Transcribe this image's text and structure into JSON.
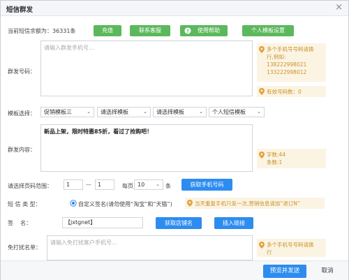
{
  "title": "短信群发",
  "close_glyph": "×",
  "balance": {
    "label": "当前短信余额为：",
    "value": "36331条"
  },
  "toolbar": {
    "recharge": "充值",
    "service": "联系客服",
    "help": "使用帮助",
    "template_settings": "个人模板设置"
  },
  "group_numbers": {
    "label": "群发号码：",
    "placeholder": "请输入群发手机号...",
    "tip_lines": [
      "多个手机号号码请换",
      "行,例如:",
      "138222998021",
      "133222998012"
    ],
    "valid_count": "有效号码数：0"
  },
  "templates": {
    "label": "模板选择：",
    "options": [
      "促销模板三",
      "请选择模板",
      "请选择模板",
      "个人短信模板"
    ]
  },
  "content": {
    "label": "群发内容：",
    "value": "新品上架，限时特惠85折，看过了抢购吧！",
    "char_count": "字数:44",
    "msg_count": "条数:1"
  },
  "range": {
    "label": "请选择页码范围：",
    "from": "1",
    "dash": "—",
    "to": "1",
    "per_page_label": "每页",
    "per_page": "10",
    "unit": "条",
    "fetch": "获取手机号码"
  },
  "sms_type": {
    "label": "短 信 类 型",
    "colon": "：",
    "option": "自定义签名(请勿使用“淘宝”和“天猫”)",
    "warning": "当天重复手机只发一次,营销信息请加“退订N”"
  },
  "signature": {
    "label": "签    名",
    "colon": "：",
    "value": "【jxtgnet】",
    "get_store": "获取店铺名",
    "insert_link": "插入链接"
  },
  "no_disturb": {
    "label": "免打扰名单：",
    "placeholder": "请输入免打扰客户手机号...",
    "tip_lines": [
      "多个手机号号码请换",
      "行"
    ]
  },
  "footer": {
    "send": "预览并发送",
    "cancel": "取消"
  },
  "colors": {
    "primary": "#2d8cf0",
    "success": "#5cb85c",
    "tip_bg": "#fcf4e3",
    "tip_fg": "#c8922a"
  }
}
